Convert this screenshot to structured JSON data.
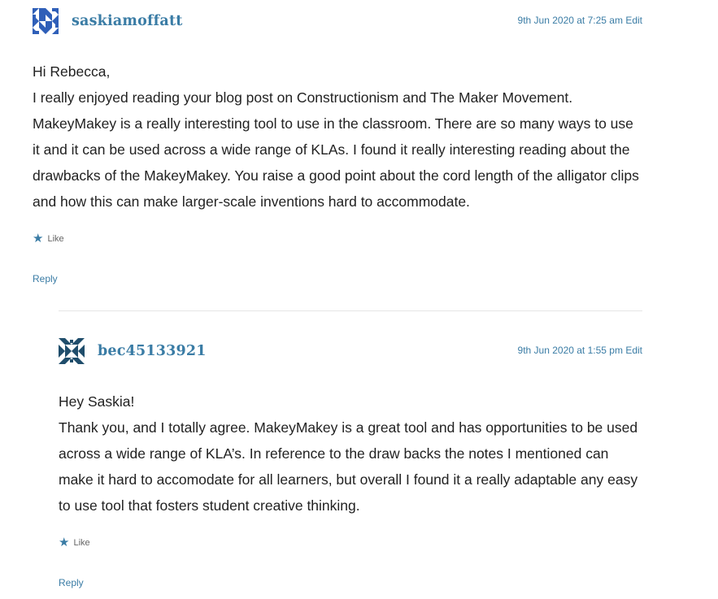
{
  "comments": [
    {
      "author": "saskiamoffatt",
      "date": "9th Jun 2020 at 7:25 am",
      "edit_label": "Edit",
      "paragraphs": [
        "Hi Rebecca,",
        "I really enjoyed reading your blog post on Constructionism and The Maker Movement. MakeyMakey is a really interesting tool to use in the classroom. There are so many ways to use it and it can be used across a wide range of KLAs. I found it really interesting reading about the drawbacks of the MakeyMakey. You raise a good point about the cord length of the alligator clips and how this can make larger-scale inventions hard to accommodate."
      ],
      "like_label": "Like",
      "reply_label": "Reply",
      "avatar_colors": {
        "fg": "#2f5fb8",
        "bg": "#ffffff"
      }
    },
    {
      "author": "bec45133921",
      "date": "9th Jun 2020 at 1:55 pm",
      "edit_label": "Edit",
      "paragraphs": [
        "Hey Saskia!",
        "Thank you, and I totally agree. MakeyMakey is a great tool and has opportunities to be used across a wide range of KLA’s. In reference to the draw backs the notes I mentioned can make it hard to accomodate for all learners, but overall I found it a really adaptable any easy to use tool that fosters student creative thinking."
      ],
      "like_label": "Like",
      "reply_label": "Reply",
      "avatar_colors": {
        "fg": "#1f4d6b",
        "bg": "#ffffff"
      }
    }
  ],
  "icons": {
    "like": "star-icon",
    "avatar": "identicon"
  },
  "colors": {
    "link": "#3a7ca5",
    "text": "#222222",
    "muted": "#666666",
    "divider": "#e6e6e6"
  }
}
